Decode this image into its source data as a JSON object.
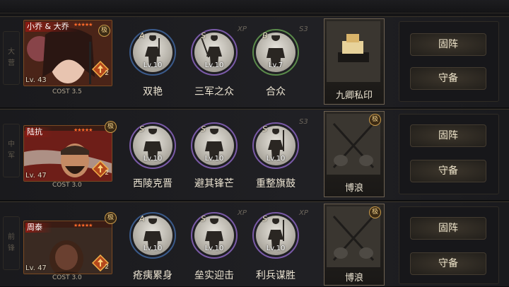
{
  "rows": [
    {
      "side_label": [
        "大",
        "营"
      ],
      "general": {
        "name": "小乔 & 大乔",
        "level": "Lv. 43",
        "cost": "COST 3.5",
        "rank": "2"
      },
      "skills": [
        {
          "grade": "A",
          "level": "Lv.10",
          "name": "双艳",
          "ring": "#3a5a8a"
        },
        {
          "grade": "S",
          "level": "Lv.10",
          "name": "三军之众",
          "ring": "#7a5aa8"
        },
        {
          "grade": "B",
          "level": "Lv.7",
          "name": "合众",
          "ring": "#5a8a4a"
        }
      ],
      "tags": [
        "XP",
        "S3"
      ],
      "item": {
        "name": "九卿私印"
      },
      "buttons": [
        "固阵",
        "守备"
      ]
    },
    {
      "side_label": [
        "中",
        "军"
      ],
      "general": {
        "name": "陆抗",
        "level": "Lv. 47",
        "cost": "COST 3.0",
        "rank": "2"
      },
      "skills": [
        {
          "grade": "S",
          "level": "Lv.10",
          "name": "西陵克晋",
          "ring": "#7a5aa8"
        },
        {
          "grade": "S",
          "level": "Lv.10",
          "name": "避其锋芒",
          "ring": "#7a5aa8"
        },
        {
          "grade": "S",
          "level": "Lv.10",
          "name": "重整旗鼓",
          "ring": "#7a5aa8"
        }
      ],
      "tags": [
        "S3"
      ],
      "item": {
        "name": "博浪",
        "badge": "极"
      },
      "buttons": [
        "固阵",
        "守备"
      ]
    },
    {
      "side_label": [
        "前",
        "锋"
      ],
      "general": {
        "name": "周泰",
        "level": "Lv. 47",
        "cost": "COST 3.0",
        "rank": "2"
      },
      "skills": [
        {
          "grade": "A",
          "level": "Lv.10",
          "name": "疮痍累身",
          "ring": "#3a5a8a"
        },
        {
          "grade": "S",
          "level": "Lv.10",
          "name": "垒实迎击",
          "ring": "#7a5aa8"
        },
        {
          "grade": "S",
          "level": "Lv.10",
          "name": "利兵谋胜",
          "ring": "#7a5aa8"
        }
      ],
      "tags": [
        "XP",
        "XP"
      ],
      "item": {
        "name": "博浪",
        "badge": "极"
      },
      "buttons": [
        "固阵",
        "守备"
      ]
    }
  ],
  "general_badge": "极",
  "stars": "★★★★★",
  "colors": {
    "accent": "#c99a4a",
    "panel": "#1c1c1f",
    "text": "#ece4d2"
  }
}
